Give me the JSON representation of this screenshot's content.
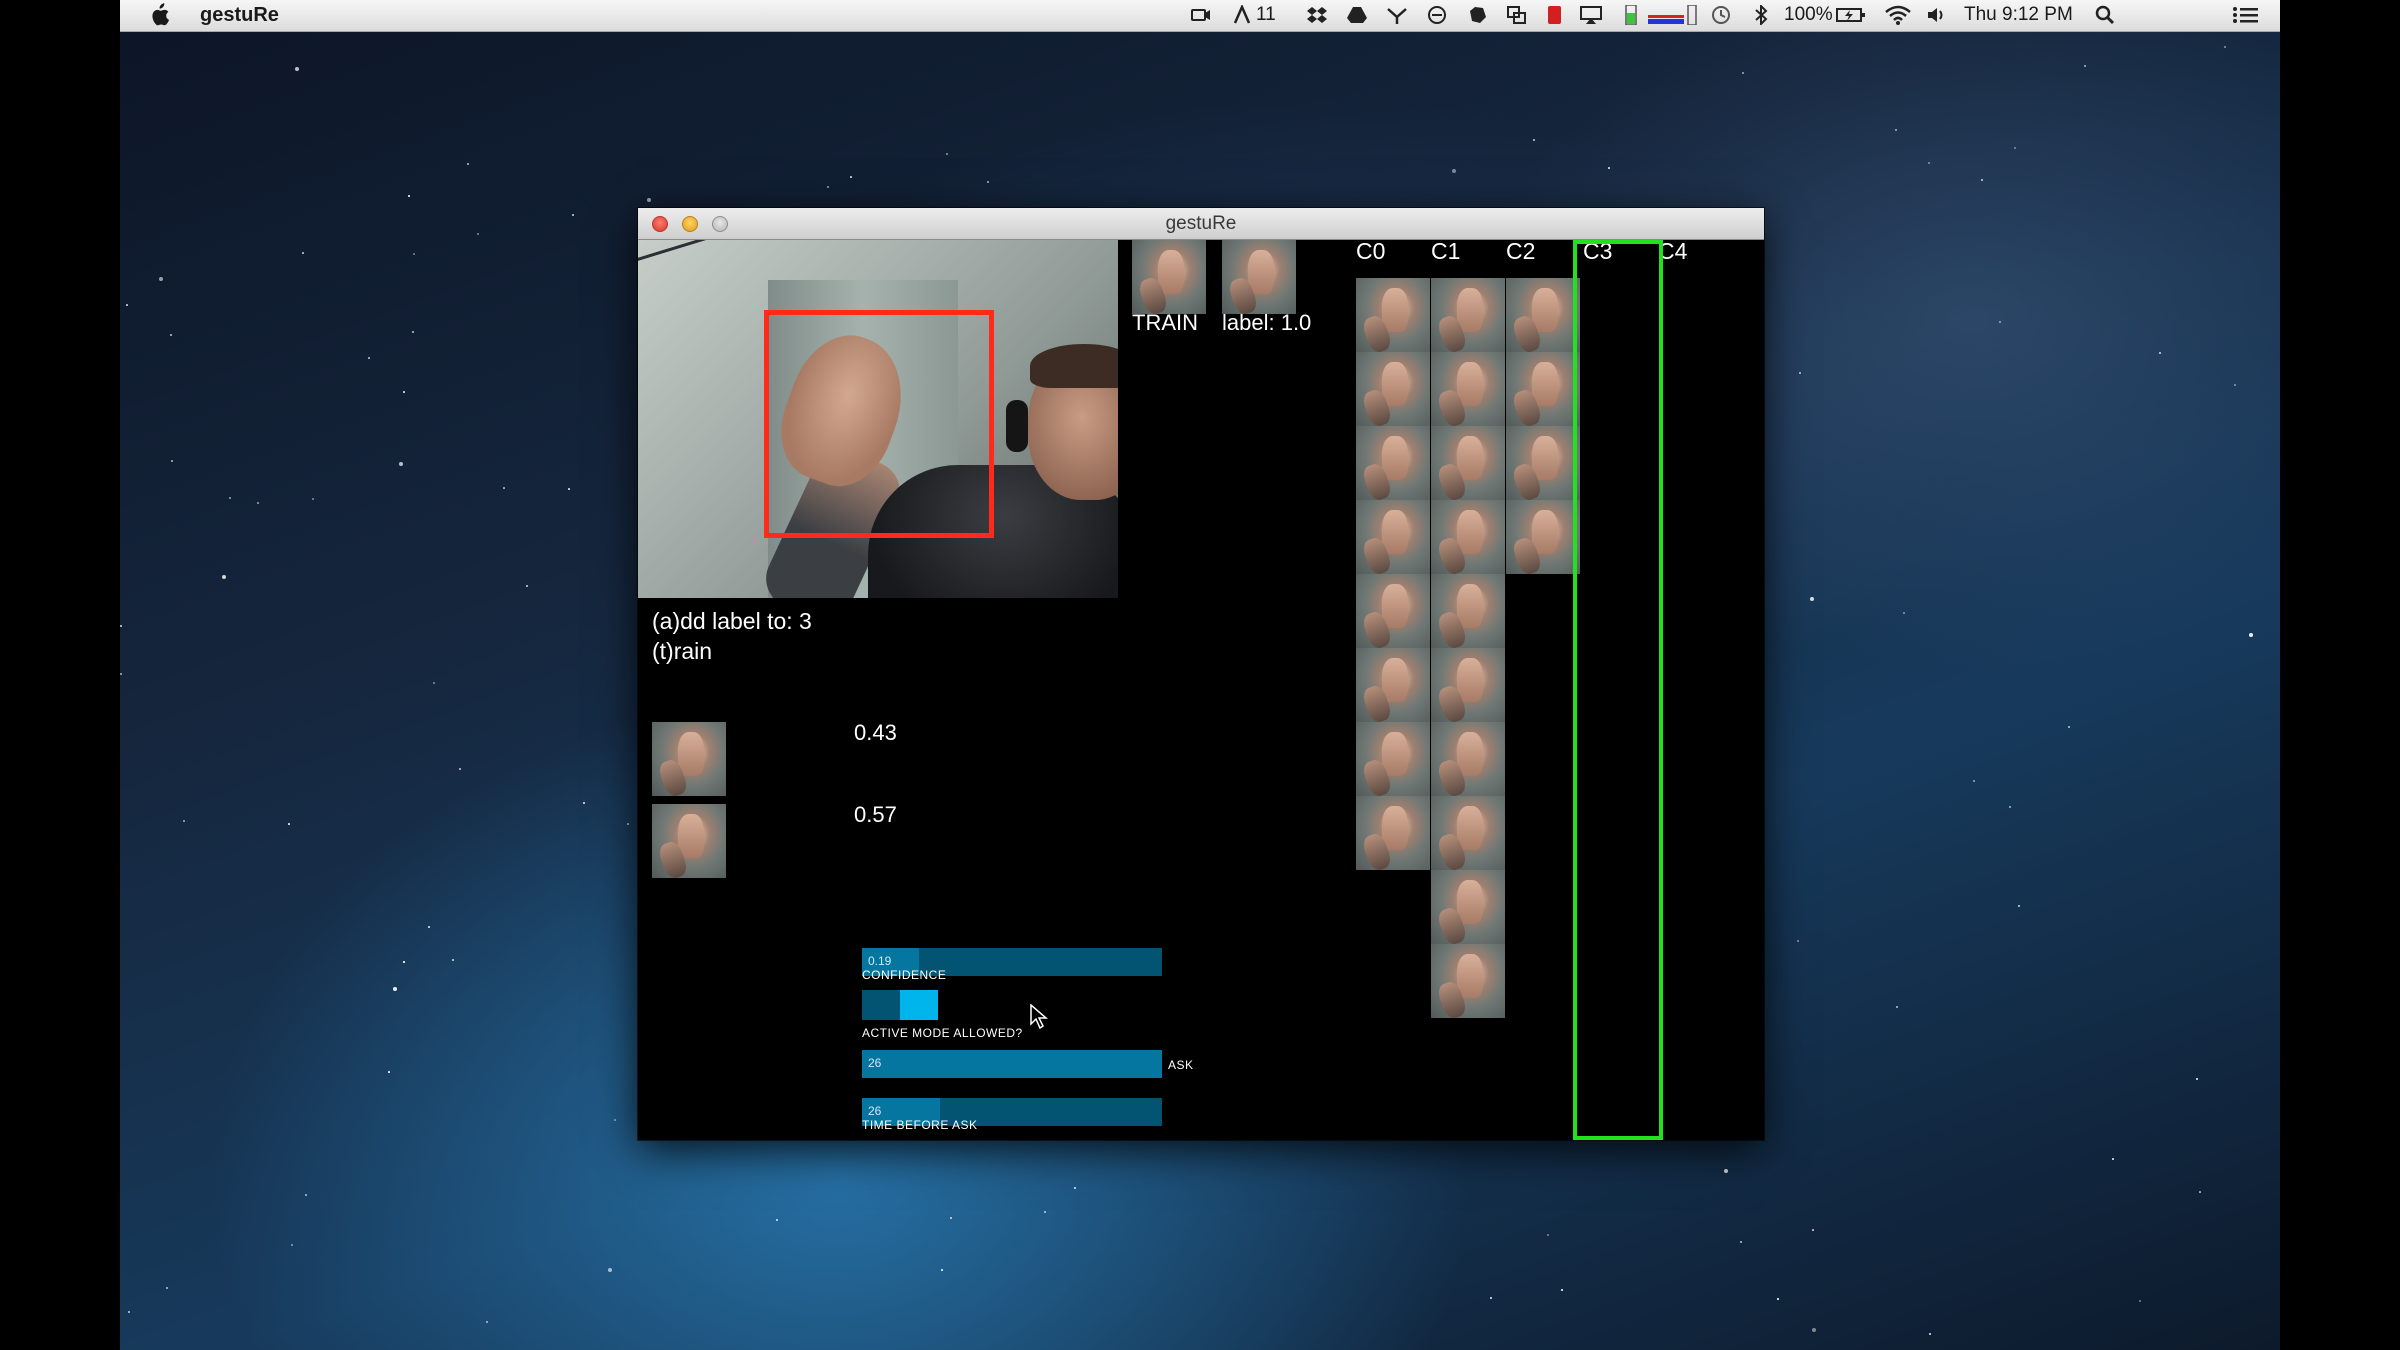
{
  "menubar": {
    "app_name": "gestuRe",
    "status_number": "11",
    "battery_percent": "100%",
    "clock": "Thu 9:12 PM"
  },
  "window": {
    "title": "gestuRe"
  },
  "overlay": {
    "train_label": "TRAIN",
    "label_text": "label: 1.0",
    "instructions_add": "(a)dd label to: 3",
    "instructions_train": "(t)rain"
  },
  "predictions": [
    {
      "value": "0.43"
    },
    {
      "value": "0.57"
    }
  ],
  "class_headers": [
    "C0",
    "C1",
    "C2",
    "C3",
    "C4"
  ],
  "class_sample_counts": [
    8,
    10,
    4,
    0,
    0
  ],
  "selected_class": "C3",
  "controls": {
    "confidence": {
      "value_text": "0.19",
      "label": "CONFIDENCE",
      "fraction": 0.19
    },
    "active_mode": {
      "label": "ACTIVE MODE ALLOWED?",
      "enabled": true
    },
    "ask": {
      "value_text": "26",
      "label": "ASK",
      "fraction": 1.0
    },
    "time_before_ask": {
      "value_text": "26",
      "label": "TIME BEFORE ASK",
      "fraction": 0.26
    }
  },
  "colors": {
    "detection_box": "#ff2a1a",
    "selected_column": "#21e21f",
    "slider_track": "#035372",
    "slider_fill": "#05769f",
    "toggle_active": "#00b4ec"
  }
}
